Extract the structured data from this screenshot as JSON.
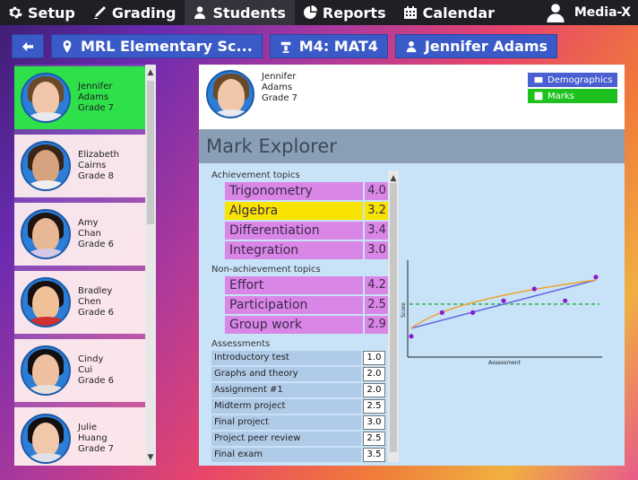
{
  "nav": {
    "items": [
      {
        "label": "Setup",
        "icon": "gear-icon"
      },
      {
        "label": "Grading",
        "icon": "pen-icon"
      },
      {
        "label": "Students",
        "icon": "person-icon",
        "active": true
      },
      {
        "label": "Reports",
        "icon": "pie-icon"
      },
      {
        "label": "Calendar",
        "icon": "calendar-icon"
      }
    ],
    "user": "Media-X"
  },
  "breadcrumbs": {
    "school": "MRL Elementary Sc...",
    "course": "M4: MAT4",
    "student": "Jennifer Adams"
  },
  "students": [
    {
      "first": "Jennifer",
      "last": "Adams",
      "grade": "Grade 7"
    },
    {
      "first": "Elizabeth",
      "last": "Cairns",
      "grade": "Grade 8"
    },
    {
      "first": "Amy",
      "last": "Chan",
      "grade": "Grade 6"
    },
    {
      "first": "Bradley",
      "last": "Chen",
      "grade": "Grade 6"
    },
    {
      "first": "Cindy",
      "last": "Cui",
      "grade": "Grade 6"
    },
    {
      "first": "Julie",
      "last": "Huang",
      "grade": "Grade 7"
    }
  ],
  "selected": {
    "first": "Jennifer",
    "last": "Adams",
    "grade": "Grade 7"
  },
  "buttons": {
    "demographics": "Demographics",
    "marks": "Marks"
  },
  "explorer": {
    "title": "Mark Explorer",
    "achievement_label": "Achievement topics",
    "achievement": [
      {
        "name": "Trigonometry",
        "score": "4.0"
      },
      {
        "name": "Algebra",
        "score": "3.2"
      },
      {
        "name": "Differentiation",
        "score": "3.4"
      },
      {
        "name": "Integration",
        "score": "3.0"
      }
    ],
    "non_achievement_label": "Non-achievement topics",
    "non_achievement": [
      {
        "name": "Effort",
        "score": "4.2"
      },
      {
        "name": "Participation",
        "score": "2.5"
      },
      {
        "name": "Group work",
        "score": "2.9"
      }
    ],
    "assessments_label": "Assessments",
    "assessments": [
      {
        "name": "Introductory test",
        "score": "1.0"
      },
      {
        "name": "Graphs and theory",
        "score": "2.0"
      },
      {
        "name": "Assignment #1",
        "score": "2.0"
      },
      {
        "name": "Midterm project",
        "score": "2.5"
      },
      {
        "name": "Final project",
        "score": "3.0"
      },
      {
        "name": "Project peer review",
        "score": "2.5"
      },
      {
        "name": "Final exam",
        "score": "3.5"
      }
    ]
  },
  "chart_data": {
    "type": "scatter",
    "xlabel": "Assessment",
    "ylabel": "Score",
    "points": [
      {
        "x": 1,
        "y": 1.0
      },
      {
        "x": 2,
        "y": 2.0
      },
      {
        "x": 3,
        "y": 2.0
      },
      {
        "x": 4,
        "y": 2.5
      },
      {
        "x": 5,
        "y": 3.0
      },
      {
        "x": 6,
        "y": 2.5
      },
      {
        "x": 7,
        "y": 3.5
      }
    ],
    "colors": {
      "points": "#8a1ad0",
      "trend": "#6a6ae0",
      "fit": "#f0a020",
      "average": "#20b040"
    }
  }
}
